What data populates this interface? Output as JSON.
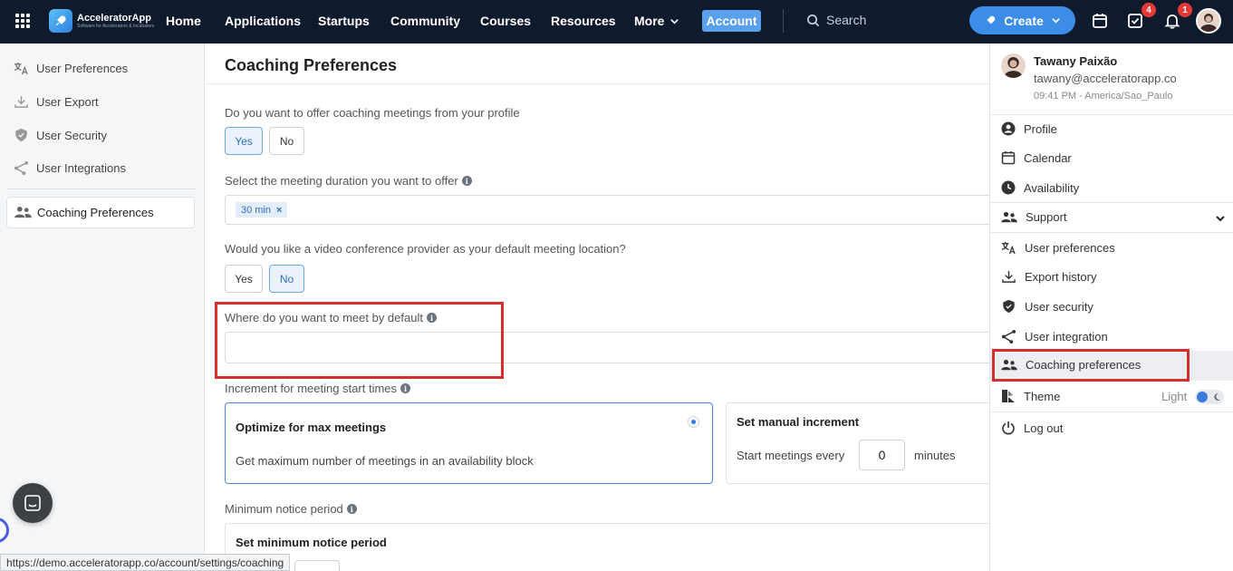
{
  "nav": {
    "logo_name": "AcceleratorApp",
    "logo_tagline": "Software for Accelerators & Incubators",
    "items": [
      "Home",
      "Applications",
      "Startups",
      "Community",
      "Courses",
      "Resources",
      "More"
    ],
    "account": "Account",
    "search_placeholder": "Search",
    "create": "Create",
    "tasks_badge": "4",
    "notifications_badge": "1"
  },
  "sidebar": {
    "items": [
      "User Preferences",
      "User Export",
      "User Security",
      "User Integrations"
    ],
    "active": "Coaching Preferences"
  },
  "main": {
    "title": "Coaching Preferences",
    "q1": {
      "label": "Do you want to offer coaching meetings from your profile",
      "yes": "Yes",
      "no": "No",
      "selected": "Yes"
    },
    "duration": {
      "label": "Select the meeting duration you want to offer",
      "chip": "30 min",
      "chip_remove": "×"
    },
    "q2": {
      "label": "Would you like a video conference provider as your default meeting location?",
      "yes": "Yes",
      "no": "No",
      "selected": "No"
    },
    "location": {
      "label": "Where do you want to meet by default",
      "value": ""
    },
    "increment": {
      "label": "Increment for meeting start times",
      "option1_title": "Optimize for max meetings",
      "option1_text": "Get maximum number of meetings in an availability block",
      "option2_title": "Set manual increment",
      "option2_prefix": "Start meetings every",
      "option2_value": "0",
      "option2_suffix": "minutes"
    },
    "notice": {
      "label": "Minimum notice period",
      "card_title": "Set minimum notice period"
    }
  },
  "dropdown": {
    "name": "Tawany Paixão",
    "email": "tawany@acceleratorapp.co",
    "time": "09:41 PM - America/Sao_Paulo",
    "items": {
      "profile": "Profile",
      "calendar": "Calendar",
      "availability": "Availability",
      "support": "Support",
      "user_preferences": "User preferences",
      "export_history": "Export history",
      "user_security": "User security",
      "user_integration": "User integration",
      "coaching_preferences": "Coaching preferences",
      "theme": "Theme",
      "theme_value": "Light",
      "logout": "Log out"
    }
  },
  "status_url": "https://demo.acceleratorapp.co/account/settings/coaching",
  "colors": {
    "nav_bg": "#0f1b2d",
    "accent": "#3b8de8",
    "highlight_red": "#d62d2d",
    "badge": "#e53935"
  }
}
